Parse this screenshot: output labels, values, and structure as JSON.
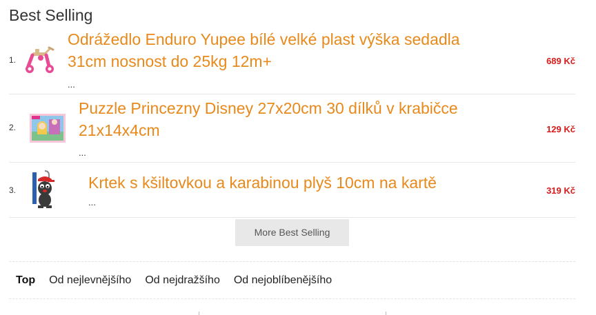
{
  "section": {
    "title": "Best Selling"
  },
  "items": [
    {
      "rank": "1.",
      "title_line1": "Odrážedlo Enduro Yupee bílé velké plast výška sedadla",
      "title_line2": "31cm nosnost do 25kg 12m+",
      "desc": "...",
      "price": "689 Kč",
      "thumb_icon": "ride-on-toy-icon"
    },
    {
      "rank": "2.",
      "title_line1": "Puzzle Princezny Disney 27x20cm 30 dílků v krabičce",
      "title_line2": "21x14x4cm",
      "desc": "...",
      "price": "129 Kč",
      "thumb_icon": "puzzle-box-icon"
    },
    {
      "rank": "3.",
      "title_line1": "Krtek s kšiltovkou a karabinou plyš 10cm na kartě",
      "desc": "...",
      "price": "319 Kč",
      "thumb_icon": "plush-mole-icon"
    }
  ],
  "more_button": {
    "label": "More Best Selling"
  },
  "sort": {
    "items": [
      "Top",
      "Od nejlevnějšího",
      "Od nejdražšího",
      "Od nejoblíbenějšího"
    ],
    "active": "Top"
  },
  "colors": {
    "title": "#e8891c",
    "price": "#d81b1b",
    "button_bg": "#e8e8e8"
  }
}
